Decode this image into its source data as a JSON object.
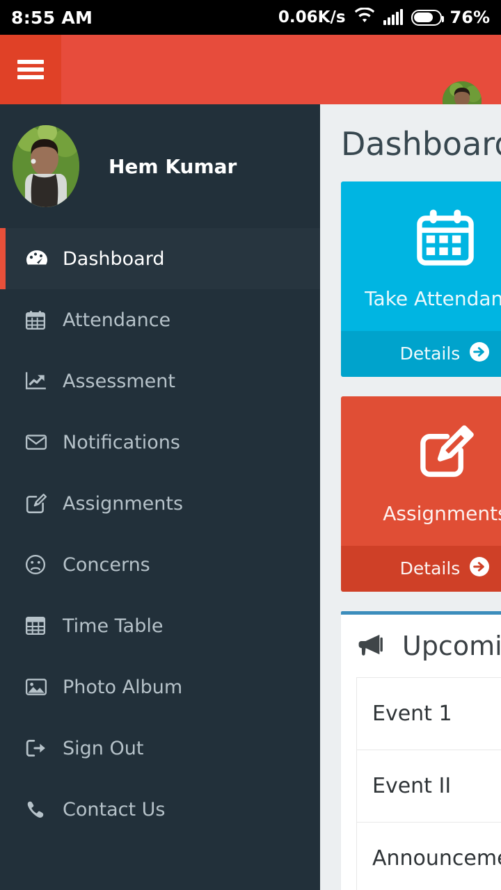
{
  "status_bar": {
    "time": "8:55 AM",
    "network_speed": "0.06K/s",
    "battery_percent": "76%",
    "battery_level": 76,
    "wifi_icon": "wifi-icon",
    "signal_icon": "signal-bars-icon",
    "battery_icon": "battery-icon"
  },
  "app_bar": {
    "menu_icon": "hamburger-menu-icon",
    "avatar_icon": "user-avatar",
    "background_color": "#e74c3c",
    "menu_button_color": "#e04127"
  },
  "drawer": {
    "background_color": "#22303a",
    "accent_color": "#e8503a",
    "user": {
      "name": "Hem Kumar",
      "avatar_icon": "user-avatar"
    },
    "items": [
      {
        "label": "Dashboard",
        "icon": "dashboard-icon",
        "active": true
      },
      {
        "label": "Attendance",
        "icon": "calendar-icon",
        "active": false
      },
      {
        "label": "Assessment",
        "icon": "chart-line-icon",
        "active": false
      },
      {
        "label": "Notifications",
        "icon": "envelope-icon",
        "active": false
      },
      {
        "label": "Assignments",
        "icon": "pencil-square-icon",
        "active": false
      },
      {
        "label": "Concerns",
        "icon": "frown-face-icon",
        "active": false
      },
      {
        "label": "Time Table",
        "icon": "table-grid-icon",
        "active": false
      },
      {
        "label": "Photo Album",
        "icon": "image-icon",
        "active": false
      },
      {
        "label": "Sign Out",
        "icon": "sign-out-icon",
        "active": false
      },
      {
        "label": "Contact Us",
        "icon": "phone-icon",
        "active": false
      }
    ]
  },
  "main": {
    "page_title": "Dashboard",
    "background_color": "#eceff1",
    "cards": [
      {
        "label": "Take Attendance",
        "icon": "calendar-icon",
        "details_label": "Details",
        "details_icon": "arrow-circle-right-icon",
        "color": "#00b5e2",
        "footer_color": "#00a3cc"
      },
      {
        "label": "Assignments",
        "icon": "pencil-square-icon",
        "details_label": "Details",
        "details_icon": "arrow-circle-right-icon",
        "color": "#e04e35",
        "footer_color": "#cf4027"
      }
    ],
    "panel": {
      "title": "Upcoming",
      "icon": "megaphone-icon",
      "border_color": "#3c8dbc",
      "rows": [
        {
          "label": "Event 1"
        },
        {
          "label": "Event II"
        },
        {
          "label": "Announcements"
        }
      ]
    }
  }
}
